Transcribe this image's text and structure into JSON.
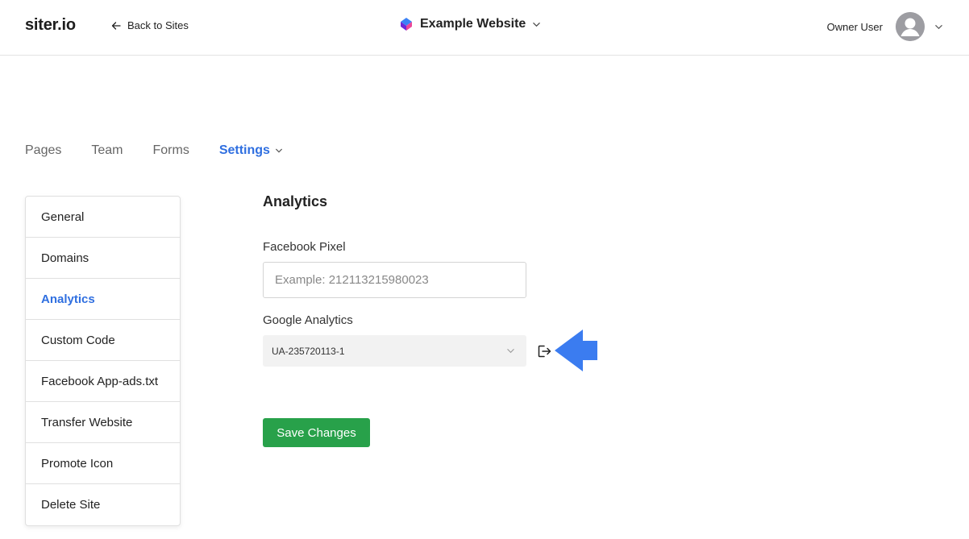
{
  "header": {
    "logo": "siter.io",
    "back_label": "Back to Sites",
    "site_name": "Example Website",
    "user_name": "Owner User"
  },
  "tabs": [
    {
      "label": "Pages"
    },
    {
      "label": "Team"
    },
    {
      "label": "Forms"
    },
    {
      "label": "Settings",
      "active": true
    }
  ],
  "sidebar": {
    "items": [
      {
        "label": "General"
      },
      {
        "label": "Domains"
      },
      {
        "label": "Analytics",
        "active": true
      },
      {
        "label": "Custom Code"
      },
      {
        "label": "Facebook App-ads.txt"
      },
      {
        "label": "Transfer Website"
      },
      {
        "label": "Promote Icon"
      },
      {
        "label": "Delete Site"
      }
    ]
  },
  "main": {
    "title": "Analytics",
    "facebook_pixel": {
      "label": "Facebook Pixel",
      "placeholder": "Example: 212113215980023",
      "value": ""
    },
    "google_analytics": {
      "label": "Google Analytics",
      "selected": "UA-235720113-1"
    },
    "save_label": "Save Changes"
  },
  "colors": {
    "accent": "#2f6fe0",
    "save_button": "#28a14a",
    "annotation_arrow": "#3b7cf0"
  },
  "icons": {
    "back": "arrow-left-icon",
    "site_logo": "cube-logo-icon",
    "dropdown": "chevron-down-icon",
    "avatar": "user-avatar-icon",
    "external": "sign-out-icon"
  }
}
